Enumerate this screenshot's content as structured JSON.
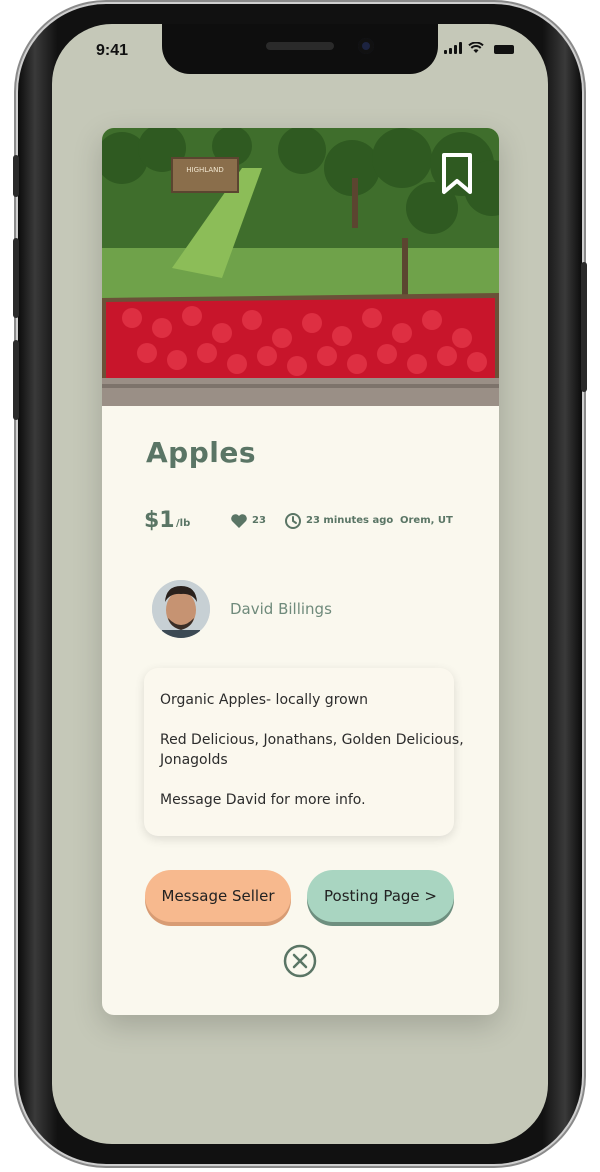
{
  "status_bar": {
    "time": "9:41"
  },
  "listing": {
    "title": "Apples",
    "price": "$1",
    "unit": "/lb",
    "likes": "23",
    "posted": "23 minutes ago",
    "location": "Orem, UT",
    "seller": "David Billings",
    "description": [
      "Organic Apples- locally grown",
      "Red Delicious, Jonathans, Golden Delicious,",
      "Jonagolds",
      "Message David for more info."
    ],
    "hero_sign": "HIGHLAND"
  },
  "actions": {
    "message_label": "Message Seller",
    "posting_label": "Posting Page >"
  },
  "icons": {
    "bookmark": "bookmark-icon",
    "heart": "heart-icon",
    "clock": "clock-icon",
    "close": "close-icon"
  },
  "colors": {
    "accent": "#5a7565",
    "screen_bg": "#c5c8b8",
    "card_bg": "#faf8ee",
    "message_button": "#f7b98e",
    "posting_button": "#a9d5c1"
  }
}
